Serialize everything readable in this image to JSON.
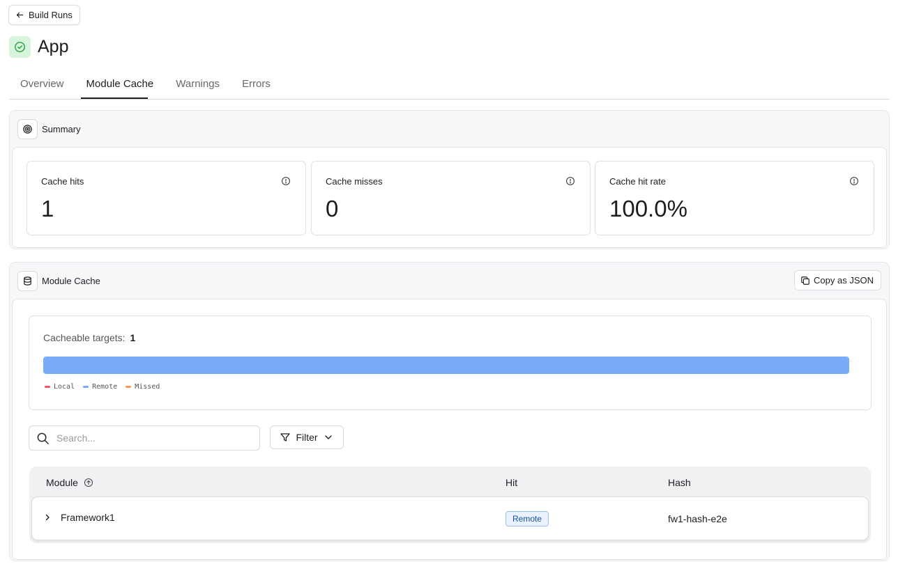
{
  "header": {
    "back_label": "Build Runs",
    "title": "App"
  },
  "tabs": [
    {
      "label": "Overview",
      "active": false
    },
    {
      "label": "Module Cache",
      "active": true
    },
    {
      "label": "Warnings",
      "active": false
    },
    {
      "label": "Errors",
      "active": false
    }
  ],
  "summary": {
    "title": "Summary",
    "stats": [
      {
        "label": "Cache hits",
        "value": "1"
      },
      {
        "label": "Cache misses",
        "value": "0"
      },
      {
        "label": "Cache hit rate",
        "value": "100.0%"
      }
    ]
  },
  "module_cache": {
    "title": "Module Cache",
    "copy_label": "Copy as JSON",
    "cacheable_label": "Cacheable targets:",
    "cacheable_count": "1",
    "bar": {
      "local": 0,
      "remote": 1,
      "missed": 0
    },
    "legend": [
      {
        "label": "Local",
        "color": "#f0506e"
      },
      {
        "label": "Remote",
        "color": "#78acf8"
      },
      {
        "label": "Missed",
        "color": "#f59a5c"
      }
    ],
    "search_placeholder": "Search...",
    "filter_label": "Filter",
    "columns": {
      "module": "Module",
      "hit": "Hit",
      "hash": "Hash"
    },
    "rows": [
      {
        "module": "Framework1",
        "hit": "Remote",
        "hash": "fw1-hash-e2e"
      }
    ]
  },
  "colors": {
    "accent_blue": "#78acf8",
    "status_green_bg": "#d6f5dc",
    "status_green": "#2f9e44"
  }
}
